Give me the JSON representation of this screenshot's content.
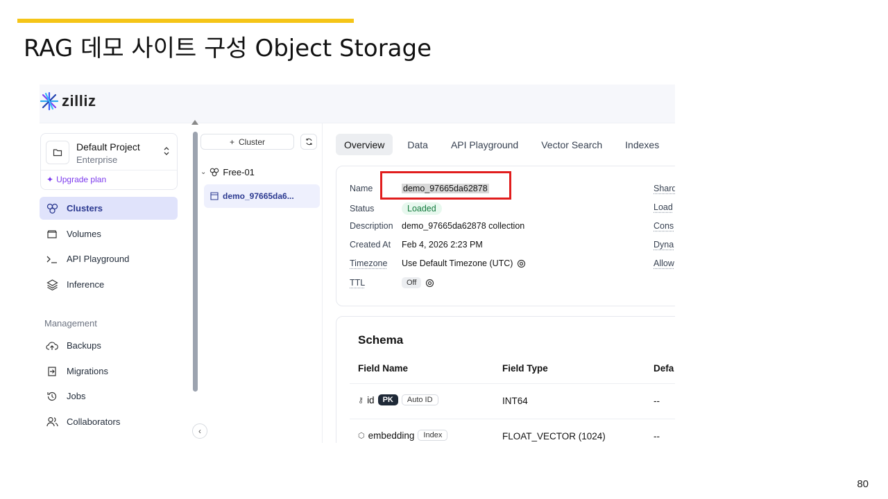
{
  "slide": {
    "title": "RAG 데모 사이트 구성 Object Storage",
    "page_number": "80",
    "accent_color": "#f5c518"
  },
  "app": {
    "logo_text": "zilliz"
  },
  "sidebar": {
    "project_name": "Default Project",
    "project_tier": "Enterprise",
    "upgrade_label": "Upgrade plan",
    "nav_items": [
      {
        "label": "Clusters",
        "icon": "clusters-icon",
        "active": true
      },
      {
        "label": "Volumes",
        "icon": "volumes-icon"
      },
      {
        "label": "API Playground",
        "icon": "terminal-icon"
      },
      {
        "label": "Inference",
        "icon": "layers-icon"
      }
    ],
    "management_label": "Management",
    "management_items": [
      {
        "label": "Backups",
        "icon": "cloud-upload-icon"
      },
      {
        "label": "Migrations",
        "icon": "migration-icon"
      },
      {
        "label": "Jobs",
        "icon": "history-icon"
      },
      {
        "label": "Collaborators",
        "icon": "users-icon"
      }
    ]
  },
  "tree": {
    "add_cluster_label": "Cluster",
    "cluster_name": "Free-01",
    "collection_name": "demo_97665da6..."
  },
  "tabs": [
    "Overview",
    "Data",
    "API Playground",
    "Vector Search",
    "Indexes"
  ],
  "overview": {
    "rows": [
      {
        "label": "Name",
        "value": "demo_97665da62878"
      },
      {
        "label": "Status",
        "value": "Loaded"
      },
      {
        "label": "Description",
        "value": "demo_97665da62878 collection"
      },
      {
        "label": "Created At",
        "value": "Feb 4, 2026 2:23 PM"
      },
      {
        "label": "Timezone",
        "value": "Use Default Timezone (UTC)"
      },
      {
        "label": "TTL",
        "value": "Off"
      }
    ],
    "right_labels": [
      "Shard",
      "Load",
      "Cons",
      "Dyna",
      "Allow"
    ],
    "status_color": "#127a3c",
    "highlight_color": "#e11d1d"
  },
  "schema": {
    "title": "Schema",
    "headers": [
      "Field Name",
      "Field Type",
      "Defa"
    ],
    "rows": [
      {
        "name": "id",
        "badges": [
          "PK",
          "Auto ID"
        ],
        "type": "INT64",
        "default": "--"
      },
      {
        "name": "embedding",
        "badges": [
          "Index"
        ],
        "type": "FLOAT_VECTOR (1024)",
        "default": "--"
      }
    ]
  }
}
